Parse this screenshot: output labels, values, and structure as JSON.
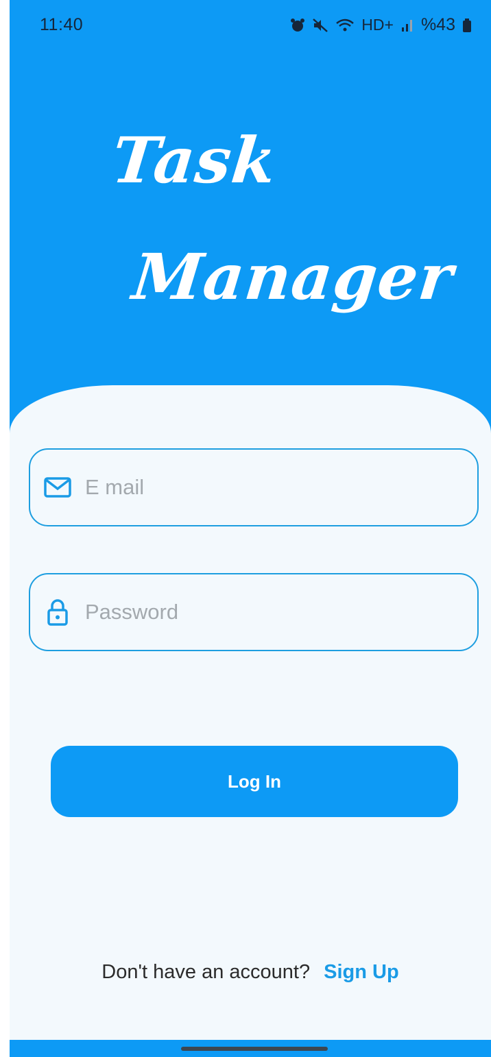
{
  "status_bar": {
    "time": "11:40",
    "battery": "%43",
    "network": "HD+",
    "icons": [
      "alarm-icon",
      "mute-icon",
      "wifi-icon",
      "signal-icon",
      "battery-icon"
    ]
  },
  "logo": {
    "line1": "Task",
    "line2": "Manager"
  },
  "form": {
    "email_placeholder": "E mail",
    "email_icon": "mail-icon",
    "password_placeholder": "Password",
    "password_icon": "lock-icon",
    "login_label": "Log In"
  },
  "footer": {
    "prompt": "Don't have an account?",
    "signup_label": "Sign Up"
  },
  "colors": {
    "primary": "#0d9af5",
    "card_bg": "#f3f9fd",
    "field_border": "#1d9ee0",
    "link": "#1a9be6"
  }
}
